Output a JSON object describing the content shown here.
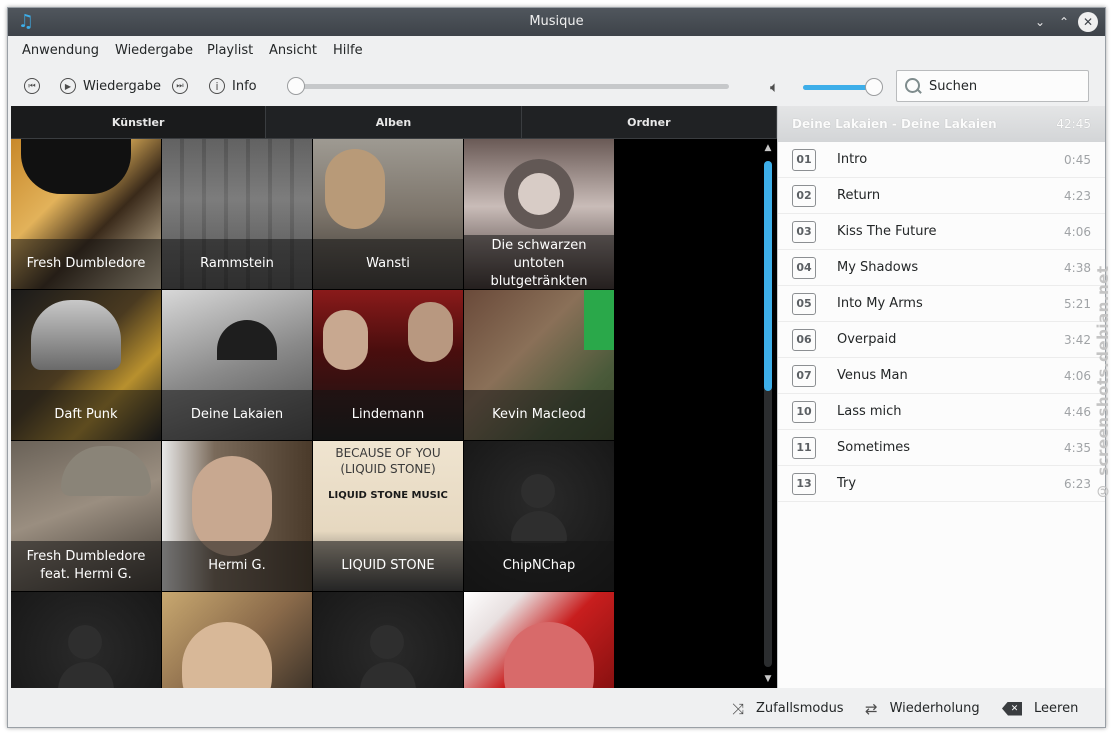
{
  "window": {
    "title": "Musique"
  },
  "menu": [
    "Anwendung",
    "Wiedergabe",
    "Playlist",
    "Ansicht",
    "Hilfe"
  ],
  "toolbar": {
    "play_label": "Wiedergabe",
    "info_label": "Info",
    "search_placeholder": "Suchen",
    "seek_progress": 0.0,
    "volume_level": 0.98
  },
  "tabs": [
    "Künstler",
    "Alben",
    "Ordner"
  ],
  "artists": [
    "Fresh Dumbledore",
    "Rammstein",
    "Wansti",
    "Die schwarzen untoten blutgetränkten Waschlappen",
    "Daft Punk",
    "Deine Lakaien",
    "Lindemann",
    "Kevin Macleod",
    "Fresh Dumbledore feat. Hermi G.",
    "Hermi G.",
    "LIQUID STONE",
    "ChipNChap",
    "",
    "",
    "",
    ""
  ],
  "album_art_text": {
    "line1": "BECAUSE OF YOU",
    "line2": "(LIQUID STONE)",
    "line3": "LIQUID STONE MUSIC"
  },
  "playlist": {
    "album": "Deine Lakaien - Deine Lakaien",
    "total": "42:45",
    "tracks": [
      {
        "num": "01",
        "title": "Intro",
        "duration": "0:45"
      },
      {
        "num": "02",
        "title": "Return",
        "duration": "4:23"
      },
      {
        "num": "03",
        "title": "Kiss The Future",
        "duration": "4:06"
      },
      {
        "num": "04",
        "title": "My Shadows",
        "duration": "4:38"
      },
      {
        "num": "05",
        "title": "Into My Arms",
        "duration": "5:21"
      },
      {
        "num": "06",
        "title": "Overpaid",
        "duration": "3:42"
      },
      {
        "num": "07",
        "title": "Venus Man",
        "duration": "4:06"
      },
      {
        "num": "10",
        "title": "Lass mich",
        "duration": "4:46"
      },
      {
        "num": "11",
        "title": "Sometimes",
        "duration": "4:35"
      },
      {
        "num": "13",
        "title": "Try",
        "duration": "6:23"
      }
    ]
  },
  "status": {
    "shuffle": "Zufallsmodus",
    "repeat": "Wiederholung",
    "clear": "Leeren"
  },
  "watermark": "© screenshots.debian.net",
  "colors": {
    "accent": "#3daee9",
    "titlebar": "#475057",
    "window_bg": "#eff0f1"
  }
}
